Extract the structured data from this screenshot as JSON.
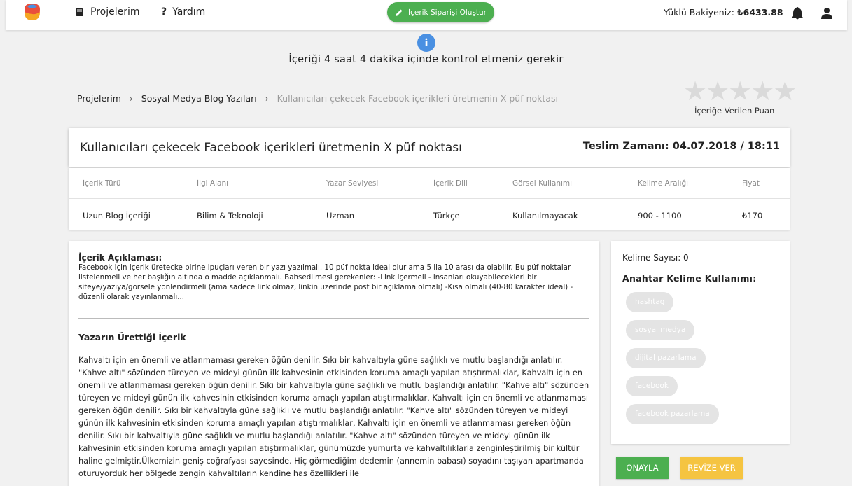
{
  "nav": {
    "projects": "Projelerim",
    "help": "Yardım",
    "create_button": "İçerik Siparişi Oluştur",
    "balance_label": "Yüklü Bakiyeniz:",
    "balance_amount": "₺6433.88"
  },
  "alert": {
    "text": "İçeriği 4 saat 4 dakika içinde kontrol etmeniz gerekir"
  },
  "breadcrumb": {
    "items": [
      "Projelerim",
      "Sosyal Medya Blog Yazıları"
    ],
    "current": "Kullanıcıları çekecek Facebook içerikleri üretmenin X püf noktası"
  },
  "rating": {
    "value": 0,
    "max": 5,
    "label": "İçeriğe Verilen Puan"
  },
  "content": {
    "title": "Kullanıcıları çekecek Facebook içerikleri üretmenin X püf noktası",
    "delivery": "Teslim Zamanı: 04.07.2018 / 18:11"
  },
  "info_table": {
    "headers": [
      "İçerik Türü",
      "İlgi Alanı",
      "Yazar Seviyesi",
      "İçerik Dili",
      "Görsel Kullanımı",
      "Kelime Aralığı",
      "Fiyat"
    ],
    "values": [
      "Uzun Blog İçeriği",
      "Bilim & Teknoloji",
      "Uzman",
      "Türkçe",
      "Kullanılmayacak",
      "900 - 1100",
      "₺170"
    ]
  },
  "description": {
    "title": "İçerik Açıklaması:",
    "text": "Facebook için içerik üretecke birine ipuçları veren bir yazı yazılmalı. 10 püf nokta ideal olur ama 5 ila 10 arası da olabilir. Bu püf noktalar listelenmeli ve her başlığın altında o madde açıklanmalı. Bahsedilmesi gerekenler: -Link içermeli - insanları okuyabilecekleri bir siteye/yazıya/görsele yönlendirmeli (ama sadece link olmaz, linkin üzerinde post bir açıklama olmalı) -Kısa olmalı (40-80 karakter ideal) -düzenli olarak yayınlanmalı..."
  },
  "written": {
    "title": "Yazarın Ürettiği İçerik",
    "text": "Kahvaltı için en önemli ve atlanmaması gereken öğün denilir. Sıkı bir kahvaltıyla güne sağlıklı ve mutlu başlandığı anlatılır. \"Kahve altı\" sözünden türeyen ve mideyi günün ilk kahvesinin etkisinden koruma amaçlı yapılan atıştırmalıklar, Kahvaltı için en önemli ve atlanmaması gereken öğün denilir. Sıkı bir kahvaltıyla güne sağlıklı ve mutlu başlandığı anlatılır. \"Kahve altı\" sözünden türeyen ve mideyi günün ilk kahvesinin etkisinden koruma amaçlı yapılan atıştırmalıklar, Kahvaltı için en önemli ve atlanmaması gereken öğün denilir. Sıkı bir kahvaltıyla güne sağlıklı ve mutlu başlandığı anlatılır. \"Kahve altı\" sözünden türeyen ve mideyi günün ilk kahvesinin etkisinden koruma amaçlı yapılan atıştırmalıklar, Kahvaltı için en önemli ve atlanmaması gereken öğün denilir. Sıkı bir kahvaltıyla güne sağlıklı ve mutlu başlandığı anlatılır. \"Kahve altı\" sözünden türeyen ve mideyi günün ilk kahvesinin etkisinden koruma amaçlı yapılan atıştırmalıklar, günümüzde yumurta ve kahvaltılıklarla zenginleştirilmiş bir kültür haline gelmiştir.Ülkemizin geniş coğrafyası sayesinde. Hiç görmediğim dedemin (annemin babası) soyadını taşıyan apartmanda oturuyorduk her bölgede zengin kahvaltıların kendine has özellikleri ile"
  },
  "side": {
    "word_count": "Kelime Sayısı: 0",
    "keyword_title": "Anahtar Kelime Kullanımı:",
    "keywords": [
      "hashtag",
      "sosyal medya",
      "dijital pazarlama",
      "facebook",
      "facebook pazarlama"
    ]
  },
  "actions": {
    "approve": "ONAYLA",
    "revise": "REVİZE VER"
  },
  "colors": {
    "green": "#4caf50",
    "yellow": "#f5c441",
    "info_blue": "#4a90e2"
  }
}
